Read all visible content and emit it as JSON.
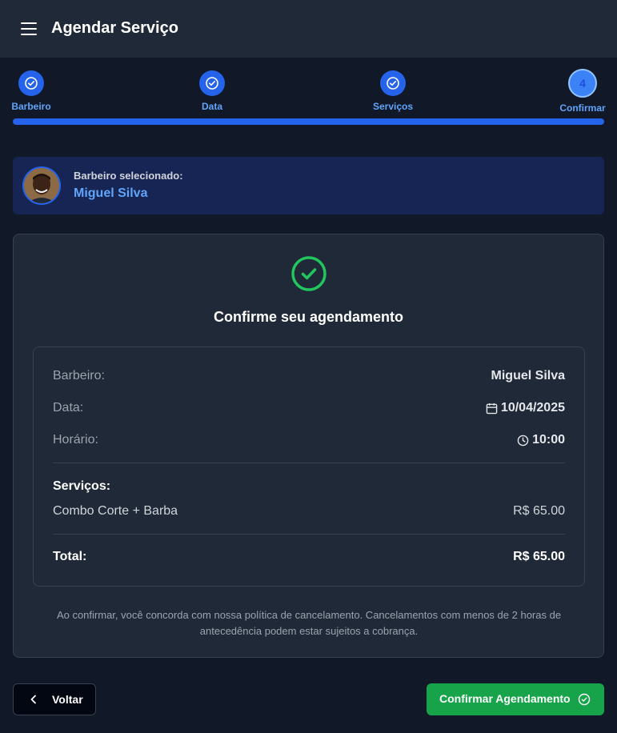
{
  "header": {
    "title": "Agendar Serviço",
    "menu_icon": "menu-icon"
  },
  "stepper": {
    "steps": [
      {
        "label": "Barbeiro",
        "status": "done"
      },
      {
        "label": "Data",
        "status": "done"
      },
      {
        "label": "Serviços",
        "status": "done"
      },
      {
        "label": "Confirmar",
        "status": "current",
        "number": "4"
      }
    ],
    "progress_fraction": 1.0
  },
  "selected_barber": {
    "caption": "Barbeiro selecionado:",
    "name": "Miguel Silva"
  },
  "confirmation": {
    "title": "Confirme seu agendamento",
    "barber_label": "Barbeiro:",
    "barber_value": "Miguel Silva",
    "date_label": "Data:",
    "date_value": "10/04/2025",
    "time_label": "Horário:",
    "time_value": "10:00",
    "services_heading": "Serviços:",
    "services": [
      {
        "name": "Combo Corte + Barba",
        "price": "R$ 65.00"
      }
    ],
    "total_label": "Total:",
    "total_value": "R$ 65.00",
    "policy_text": "Ao confirmar, você concorda com nossa política de cancelamento. Cancelamentos com menos de 2 horas de antecedência podem estar sujeitos a cobrança."
  },
  "actions": {
    "back_label": "Voltar",
    "confirm_label": "Confirmar Agendamento"
  },
  "colors": {
    "primary": "#2563eb",
    "success": "#16a34a",
    "background": "#111827",
    "surface": "#1f2937"
  }
}
